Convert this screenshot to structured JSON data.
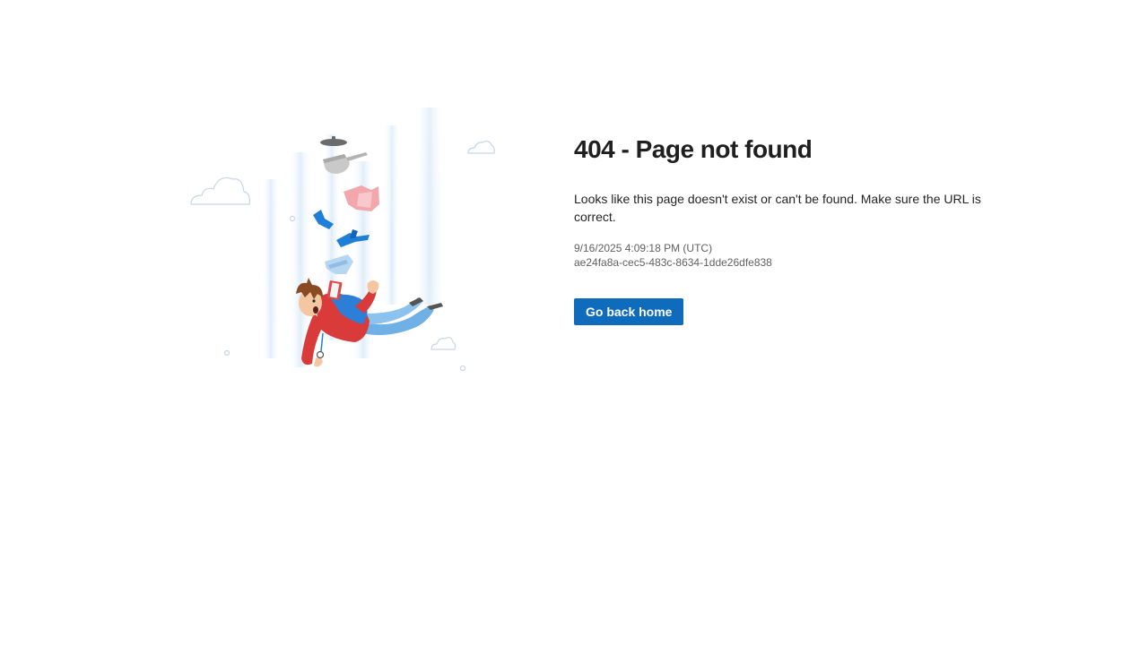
{
  "page": {
    "title": "404 - Page not found",
    "message": "Looks like this page doesn't exist or can't be found. Make sure the URL is correct.",
    "timestamp": "9/16/2025 4:09:18 PM (UTC)",
    "request_id": "ae24fa8a-cec5-483c-8634-1dde26dfe838",
    "button_label": "Go back home"
  },
  "illustration": {
    "icon": "falling-person-illustration",
    "colors": {
      "accent": "#0f6cbd",
      "jacket": "#d93a3a",
      "pants": "#6fb0e6",
      "skin": "#f5c7a1",
      "hair": "#8a4b22",
      "cloud": "#c7d6e4"
    }
  },
  "colors": {
    "primary_button": "#0f6cbd",
    "title_text": "#1f1f1f",
    "meta_text": "#616161"
  }
}
